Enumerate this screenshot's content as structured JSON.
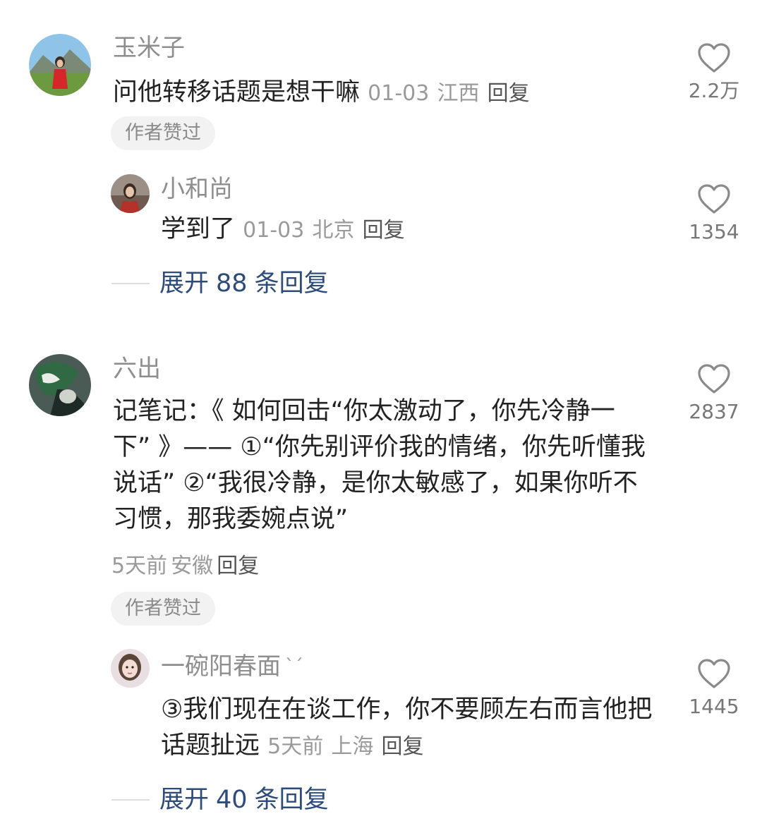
{
  "comments": [
    {
      "username": "玉米子",
      "text": "问他转移话题是想干嘛",
      "date": "01-03",
      "location": "江西",
      "reply_label": "回复",
      "author_liked": "作者赞过",
      "likes": "2.2万",
      "sub_reply": {
        "username": "小和尚",
        "text": "学到了",
        "date": "01-03",
        "location": "北京",
        "reply_label": "回复",
        "likes": "1354"
      },
      "expand": {
        "prefix": "展开",
        "count": "88",
        "suffix": "条回复"
      }
    },
    {
      "username": "六出",
      "text": "记笔记：《 如何回击“你太激动了，你先冷静一下” 》—— ①“你先别评价我的情绪，你先听懂我说话” ②“我很冷静，是你太敏感了，如果你听不习惯，那我委婉点说”",
      "date": "5天前",
      "location": "安徽",
      "reply_label": "回复",
      "author_liked": "作者赞过",
      "likes": "2837",
      "sub_reply": {
        "username": "一碗阳春面",
        "username_suffix": "ˋˊ",
        "text": "③我们现在在谈工作，你不要顾左右而言他把话题扯远",
        "date": "5天前",
        "location": "上海",
        "reply_label": "回复",
        "likes": "1445"
      },
      "expand": {
        "prefix": "展开",
        "count": "40",
        "suffix": "条回复"
      }
    }
  ],
  "icons": {
    "like": "heart-outline-icon"
  },
  "colors": {
    "link": "#2d4c7a",
    "meta": "#9a9a9a",
    "text": "#222222"
  }
}
